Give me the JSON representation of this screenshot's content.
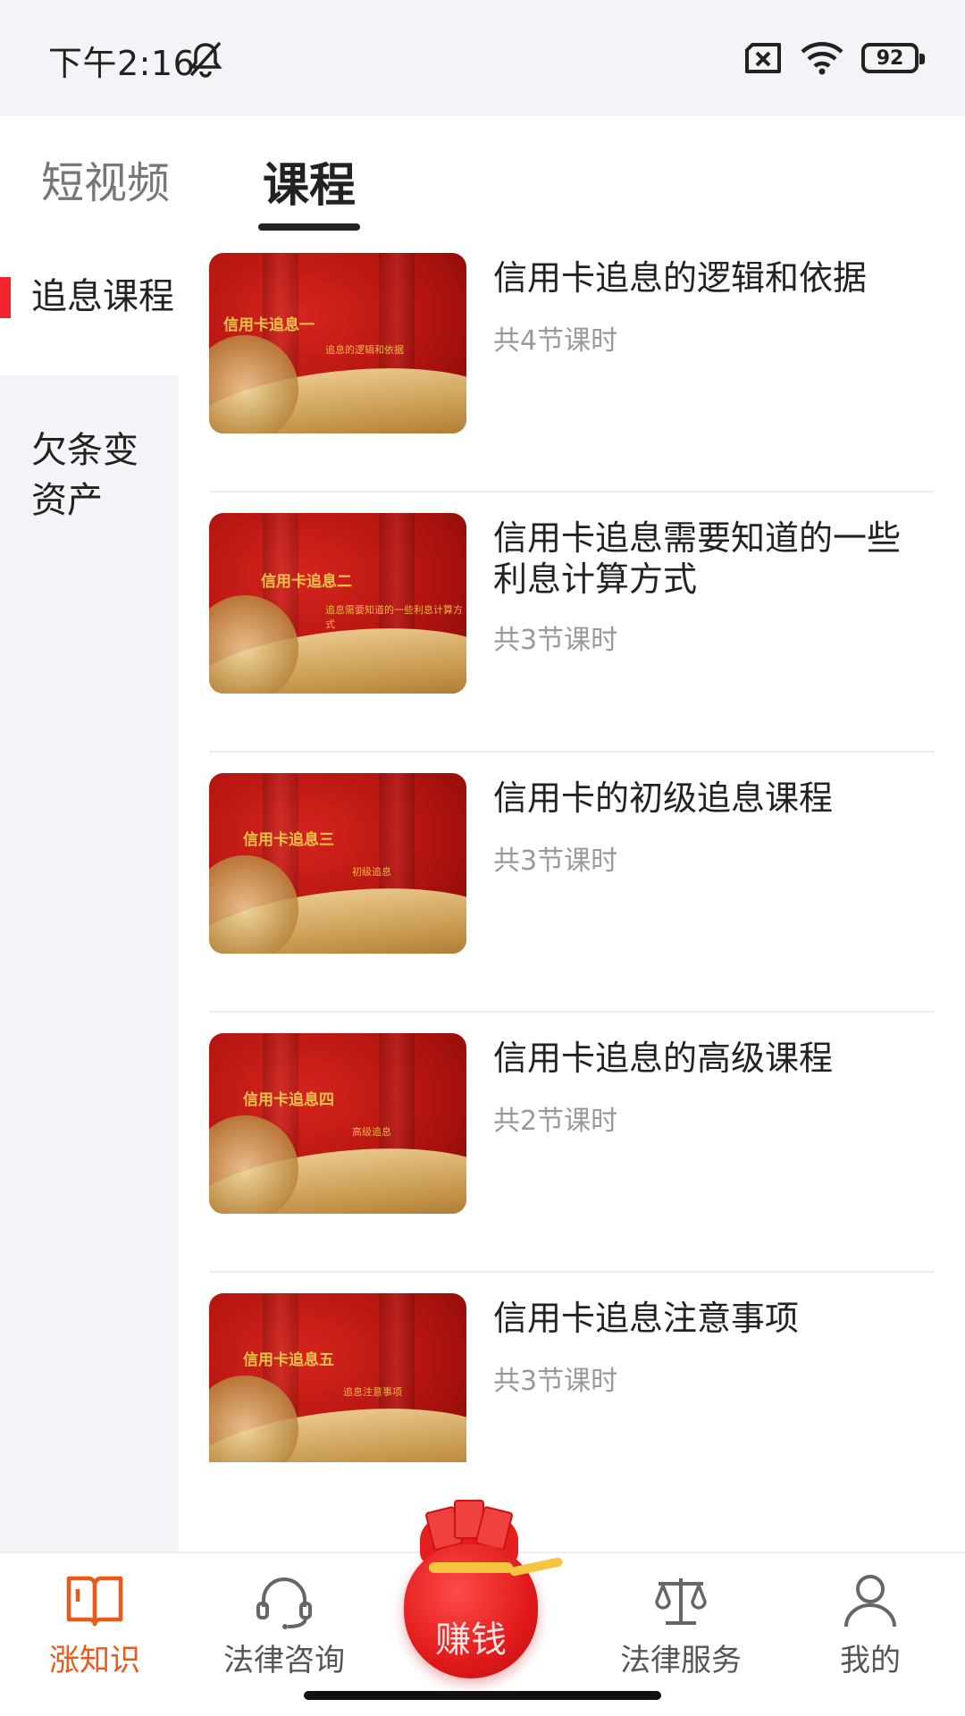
{
  "status_bar": {
    "time": "下午2:16",
    "battery": "92",
    "icons": [
      "mute-icon",
      "sim-icon",
      "wifi-icon",
      "battery-icon"
    ]
  },
  "tabs": [
    {
      "label": "短视频",
      "active": false
    },
    {
      "label": "课程",
      "active": true
    }
  ],
  "sidebar": {
    "items": [
      {
        "label": "追息课程",
        "active": true
      },
      {
        "label": "欠条变资产",
        "active": false
      }
    ]
  },
  "courses": [
    {
      "title": "信用卡追息的逻辑和依据",
      "meta": "共4节课时",
      "thumb_title": "信用卡追息一",
      "thumb_sub": "追息的逻辑和依据"
    },
    {
      "title": "信用卡追息需要知道的一些利息计算方式",
      "meta": "共3节课时",
      "thumb_title": "信用卡追息二",
      "thumb_sub": "追息需要知道的一些利息计算方式"
    },
    {
      "title": "信用卡的初级追息课程",
      "meta": "共3节课时",
      "thumb_title": "信用卡追息三",
      "thumb_sub": "初级追息"
    },
    {
      "title": "信用卡追息的高级课程",
      "meta": "共2节课时",
      "thumb_title": "信用卡追息四",
      "thumb_sub": "高级追息"
    },
    {
      "title": "信用卡追息注意事项",
      "meta": "共3节课时",
      "thumb_title": "信用卡追息五",
      "thumb_sub": "追息注意事项"
    }
  ],
  "bottom_nav": {
    "items": [
      {
        "label": "涨知识",
        "icon": "book-icon",
        "active": true
      },
      {
        "label": "法律咨询",
        "icon": "headset-icon",
        "active": false
      },
      {
        "label": "赚钱",
        "icon": "money-bag-icon",
        "active": false
      },
      {
        "label": "法律服务",
        "icon": "scale-icon",
        "active": false
      },
      {
        "label": "我的",
        "icon": "user-icon",
        "active": false
      }
    ]
  },
  "colors": {
    "accent": "#e8591a",
    "sidebar_marker": "#f2232b",
    "earn_red": "#e11a1a"
  }
}
